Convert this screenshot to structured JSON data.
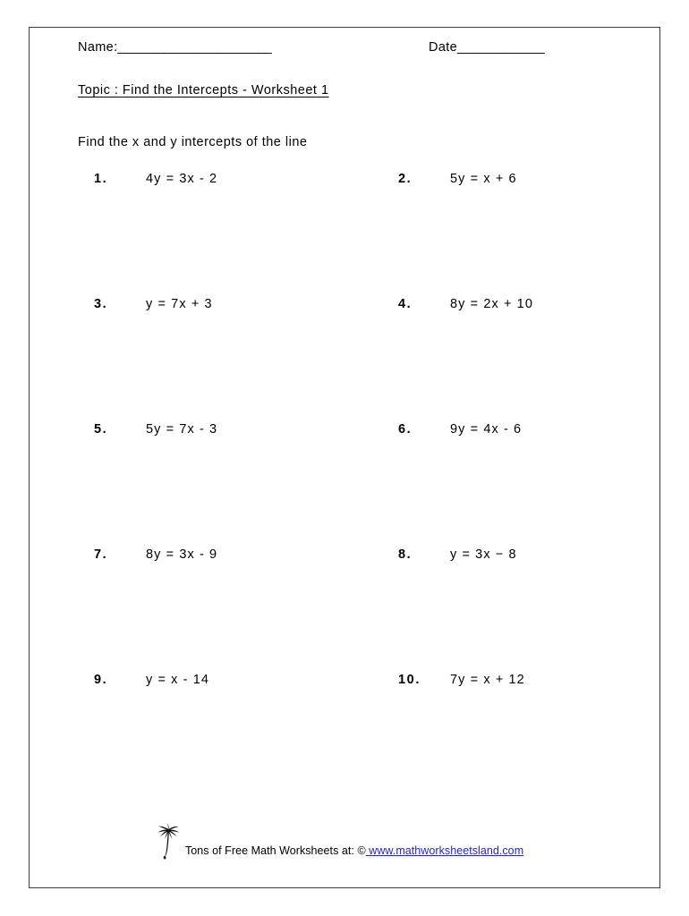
{
  "page": {
    "header": {
      "name_label": "Name:",
      "name_rule": "_______________________",
      "date_label": "Date",
      "date_rule": "_____________"
    },
    "topic": "Topic : Find the Intercepts - Worksheet 1",
    "instruction": "Find the x and y intercepts of the line"
  },
  "problems": [
    {
      "number": "1.",
      "equation": "4y  =  3x  -  2"
    },
    {
      "number": "2.",
      "equation": "5y  =  x  +  6"
    },
    {
      "number": "3.",
      "equation": "y  =  7x  +  3"
    },
    {
      "number": "4.",
      "equation": "8y  =  2x  +  10"
    },
    {
      "number": "5.",
      "equation": "5y  =  7x  -  3"
    },
    {
      "number": "6.",
      "equation": "9y  =  4x  -  6"
    },
    {
      "number": "7.",
      "equation": "8y  =  3x  -  9"
    },
    {
      "number": "8.",
      "equation": "y  =  3x  −  8"
    },
    {
      "number": "9.",
      "equation": "y  =  x  -  14"
    },
    {
      "number": "10.",
      "equation": "7y  =  x  +  12"
    }
  ],
  "footer": {
    "icon": "palm-tree-icon",
    "text": "Tons of Free Math Worksheets at: ©",
    "link_text": " www.mathworksheetsland.com",
    "link_color": "#2222dd"
  }
}
